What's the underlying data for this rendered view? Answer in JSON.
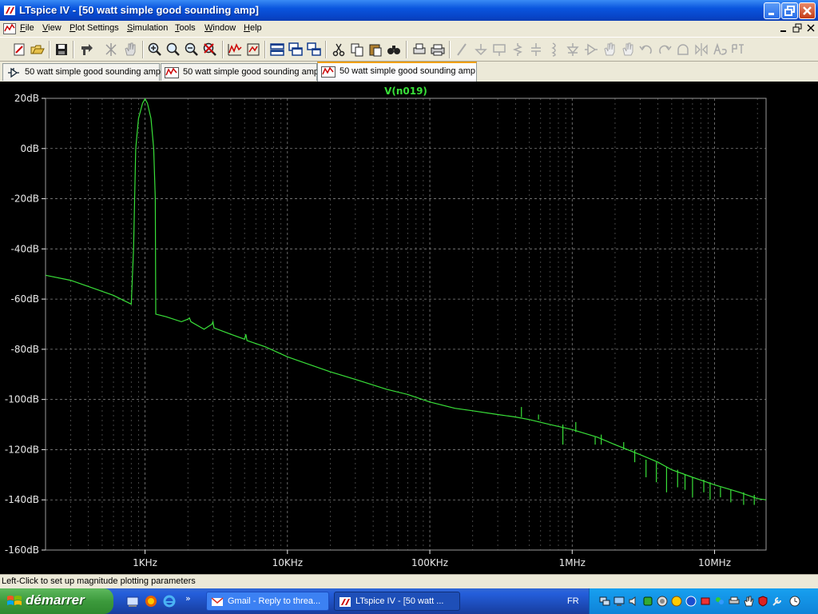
{
  "window": {
    "title": "LTspice IV - [50 watt simple good sounding amp]"
  },
  "menu": {
    "items": [
      "File",
      "View",
      "Plot Settings",
      "Simulation",
      "Tools",
      "Window",
      "Help"
    ]
  },
  "toolbar": {
    "icons": [
      "run-icon",
      "open-icon",
      "save-icon",
      "control-panel-icon",
      "autorange-icon",
      "pan-icon",
      "zoom-in-icon",
      "zoom-box-icon",
      "zoom-out-icon",
      "zoom-cancel-icon",
      "autoscale-icon",
      "fit-icon",
      "tile-horizontal-icon",
      "cascade-icon",
      "tile-vertical-icon",
      "cut-icon",
      "copy-icon",
      "paste-icon",
      "find-icon",
      "print-preview-icon",
      "print-icon",
      "wire-icon",
      "ground-icon",
      "label-net-icon",
      "resistor-icon",
      "capacitor-icon",
      "inductor-icon",
      "diode-icon",
      "component-icon",
      "move-icon",
      "drag-icon",
      "undo-icon",
      "redo-icon",
      "rotate-icon",
      "mirror-icon",
      "text-icon",
      "spice-directive-icon"
    ]
  },
  "tabs": [
    {
      "label": "50 watt simple good sounding amp",
      "icon": "schematic-icon",
      "active": false
    },
    {
      "label": "50 watt simple good sounding amp",
      "icon": "waveform-icon",
      "active": false
    },
    {
      "label": "50 watt simple good sounding amp",
      "icon": "waveform-icon",
      "active": true
    }
  ],
  "status": {
    "text": "Left-Click to set up magnitude plotting parameters"
  },
  "taskbar": {
    "start_label": "démarrer",
    "tasks": [
      {
        "label": "Gmail - Reply to threa...",
        "icon": "gmail-icon",
        "active": false
      },
      {
        "label": "LTspice IV - [50 watt ...",
        "icon": "ltspice-icon",
        "active": true
      }
    ],
    "language": "FR",
    "tray_icons": [
      "network-icon",
      "monitor-icon",
      "speaker-icon",
      "antivirus-icon",
      "shield-icon",
      "update-icon",
      "bluetooth-icon",
      "usb-icon",
      "messenger-icon",
      "printer-icon",
      "hand-icon",
      "security-icon",
      "wrench-icon",
      "clock-icon"
    ]
  },
  "colors": {
    "background": "#000000",
    "trace": "#39e039",
    "grid": "#9a9a9a",
    "axis_text": "#e8e8e8"
  },
  "chart_data": {
    "type": "line",
    "trace_label": "V(n019)",
    "x_scale": "log",
    "x_unit": "Hz",
    "xlim": [
      200,
      23000000
    ],
    "ylim": [
      -160,
      20
    ],
    "grid": true,
    "x_ticks": [
      1000,
      10000,
      100000,
      1000000,
      10000000
    ],
    "x_tick_labels": [
      "1KHz",
      "10KHz",
      "100KHz",
      "1MHz",
      "10MHz"
    ],
    "y_ticks": [
      20,
      0,
      -20,
      -40,
      -60,
      -80,
      -100,
      -120,
      -140,
      -160
    ],
    "y_tick_labels": [
      "20dB",
      "0dB",
      "-20dB",
      "-40dB",
      "-60dB",
      "-80dB",
      "-100dB",
      "-120dB",
      "-140dB",
      "-160dB"
    ],
    "series": [
      {
        "name": "V(n019)",
        "color": "#39e039",
        "points": [
          [
            200,
            -50.5
          ],
          [
            300,
            -52.5
          ],
          [
            450,
            -56
          ],
          [
            600,
            -58.5
          ],
          [
            800,
            -62
          ],
          [
            830,
            -40
          ],
          [
            860,
            0
          ],
          [
            900,
            12
          ],
          [
            960,
            18
          ],
          [
            1000,
            19.8
          ],
          [
            1040,
            18
          ],
          [
            1100,
            12
          ],
          [
            1150,
            0
          ],
          [
            1180,
            -20
          ],
          [
            1190,
            -66
          ],
          [
            1400,
            -67
          ],
          [
            1800,
            -69
          ],
          [
            2000,
            -68
          ],
          [
            2050,
            -67.5
          ],
          [
            2100,
            -69
          ],
          [
            2600,
            -72
          ],
          [
            2950,
            -70
          ],
          [
            3000,
            -69
          ],
          [
            3050,
            -71.5
          ],
          [
            4000,
            -74
          ],
          [
            5000,
            -76
          ],
          [
            5100,
            -74
          ],
          [
            5200,
            -76.5
          ],
          [
            7000,
            -79
          ],
          [
            10000,
            -83
          ],
          [
            15000,
            -86.5
          ],
          [
            20000,
            -89
          ],
          [
            30000,
            -92
          ],
          [
            50000,
            -96
          ],
          [
            70000,
            -98
          ],
          [
            100000,
            -101
          ],
          [
            150000,
            -103.5
          ],
          [
            200000,
            -104.5
          ],
          [
            300000,
            -106
          ],
          [
            400000,
            -107
          ],
          [
            500000,
            -108
          ],
          [
            700000,
            -110
          ],
          [
            1000000,
            -112
          ],
          [
            1500000,
            -115
          ],
          [
            2000000,
            -118
          ],
          [
            3000000,
            -122
          ],
          [
            4000000,
            -125
          ],
          [
            5000000,
            -128
          ],
          [
            7000000,
            -131
          ],
          [
            10000000,
            -134
          ],
          [
            15000000,
            -137
          ],
          [
            20000000,
            -139.5
          ],
          [
            23000000,
            -140
          ]
        ]
      }
    ],
    "spurs": [
      {
        "x": 440000,
        "y_min": -107,
        "y_max": -103
      },
      {
        "x": 580000,
        "y_min": -108,
        "y_max": -106
      },
      {
        "x": 860000,
        "y_min": -118,
        "y_max": -110
      },
      {
        "x": 1060000,
        "y_min": -113,
        "y_max": -109
      },
      {
        "x": 1450000,
        "y_min": -118,
        "y_max": -115
      },
      {
        "x": 1600000,
        "y_min": -118,
        "y_max": -114
      },
      {
        "x": 2300000,
        "y_min": -120,
        "y_max": -117
      },
      {
        "x": 2750000,
        "y_min": -125,
        "y_max": -120
      },
      {
        "x": 3300000,
        "y_min": -131,
        "y_max": -124
      },
      {
        "x": 3900000,
        "y_min": -133,
        "y_max": -125
      },
      {
        "x": 4600000,
        "y_min": -137,
        "y_max": -127
      },
      {
        "x": 5500000,
        "y_min": -135,
        "y_max": -128
      },
      {
        "x": 6200000,
        "y_min": -136,
        "y_max": -130
      },
      {
        "x": 7000000,
        "y_min": -139,
        "y_max": -131
      },
      {
        "x": 8400000,
        "y_min": -137,
        "y_max": -132
      },
      {
        "x": 9300000,
        "y_min": -140,
        "y_max": -133
      },
      {
        "x": 11000000,
        "y_min": -139,
        "y_max": -135
      },
      {
        "x": 13000000,
        "y_min": -141,
        "y_max": -136
      },
      {
        "x": 16000000,
        "y_min": -142,
        "y_max": -137
      },
      {
        "x": 19000000,
        "y_min": -142,
        "y_max": -138
      }
    ]
  }
}
